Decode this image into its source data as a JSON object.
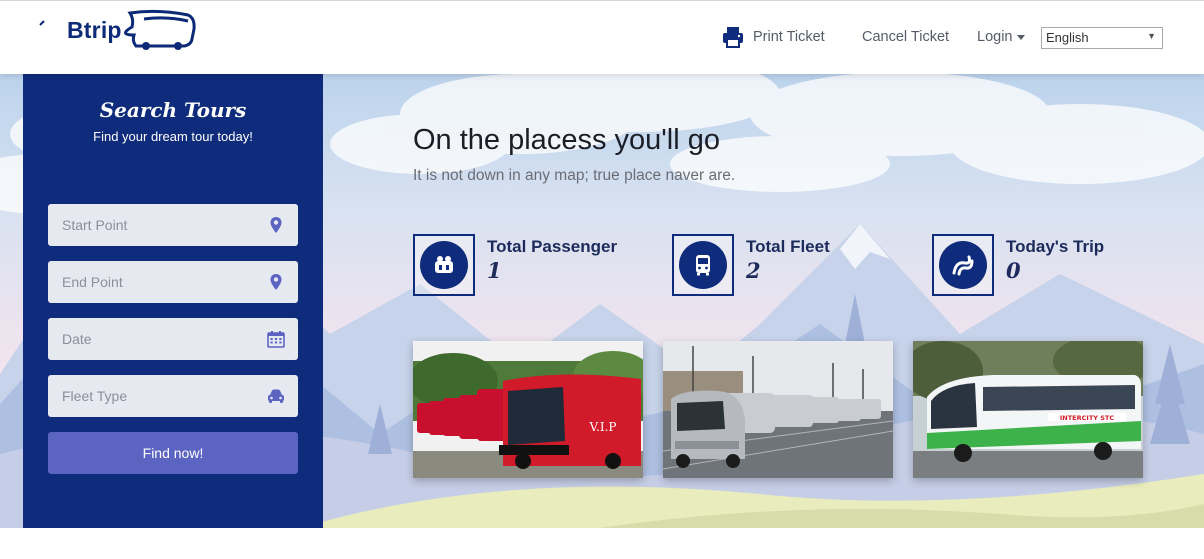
{
  "header": {
    "logo_text": "Btrip",
    "nav": {
      "print_ticket": "Print Ticket",
      "cancel_ticket": "Cancel Ticket",
      "login": "Login"
    },
    "language": {
      "selected": "English"
    }
  },
  "search": {
    "title": "Search Tours",
    "subtitle": "Find your dream tour today!",
    "fields": {
      "start_point": "Start Point",
      "end_point": "End Point",
      "date": "Date",
      "fleet_type": "Fleet Type"
    },
    "button": "Find now!"
  },
  "hero": {
    "headline": "On the placess you'll go",
    "subheadline": "It is not down in any map; true place naver are."
  },
  "stats": [
    {
      "label": "Total Passenger",
      "value": "1",
      "icon": "passenger-icon"
    },
    {
      "label": "Total Fleet",
      "value": "2",
      "icon": "bus-icon"
    },
    {
      "label": "Today's Trip",
      "value": "0",
      "icon": "road-icon"
    }
  ],
  "photos": {
    "bus_1_livery": "V.I.P",
    "bus_3_livery": "INTERCITY STC"
  },
  "colors": {
    "navy": "#0f2b7b",
    "button": "#5c64c2",
    "field_bg": "#e7e9f0",
    "icon_purple": "#5c64c2"
  }
}
